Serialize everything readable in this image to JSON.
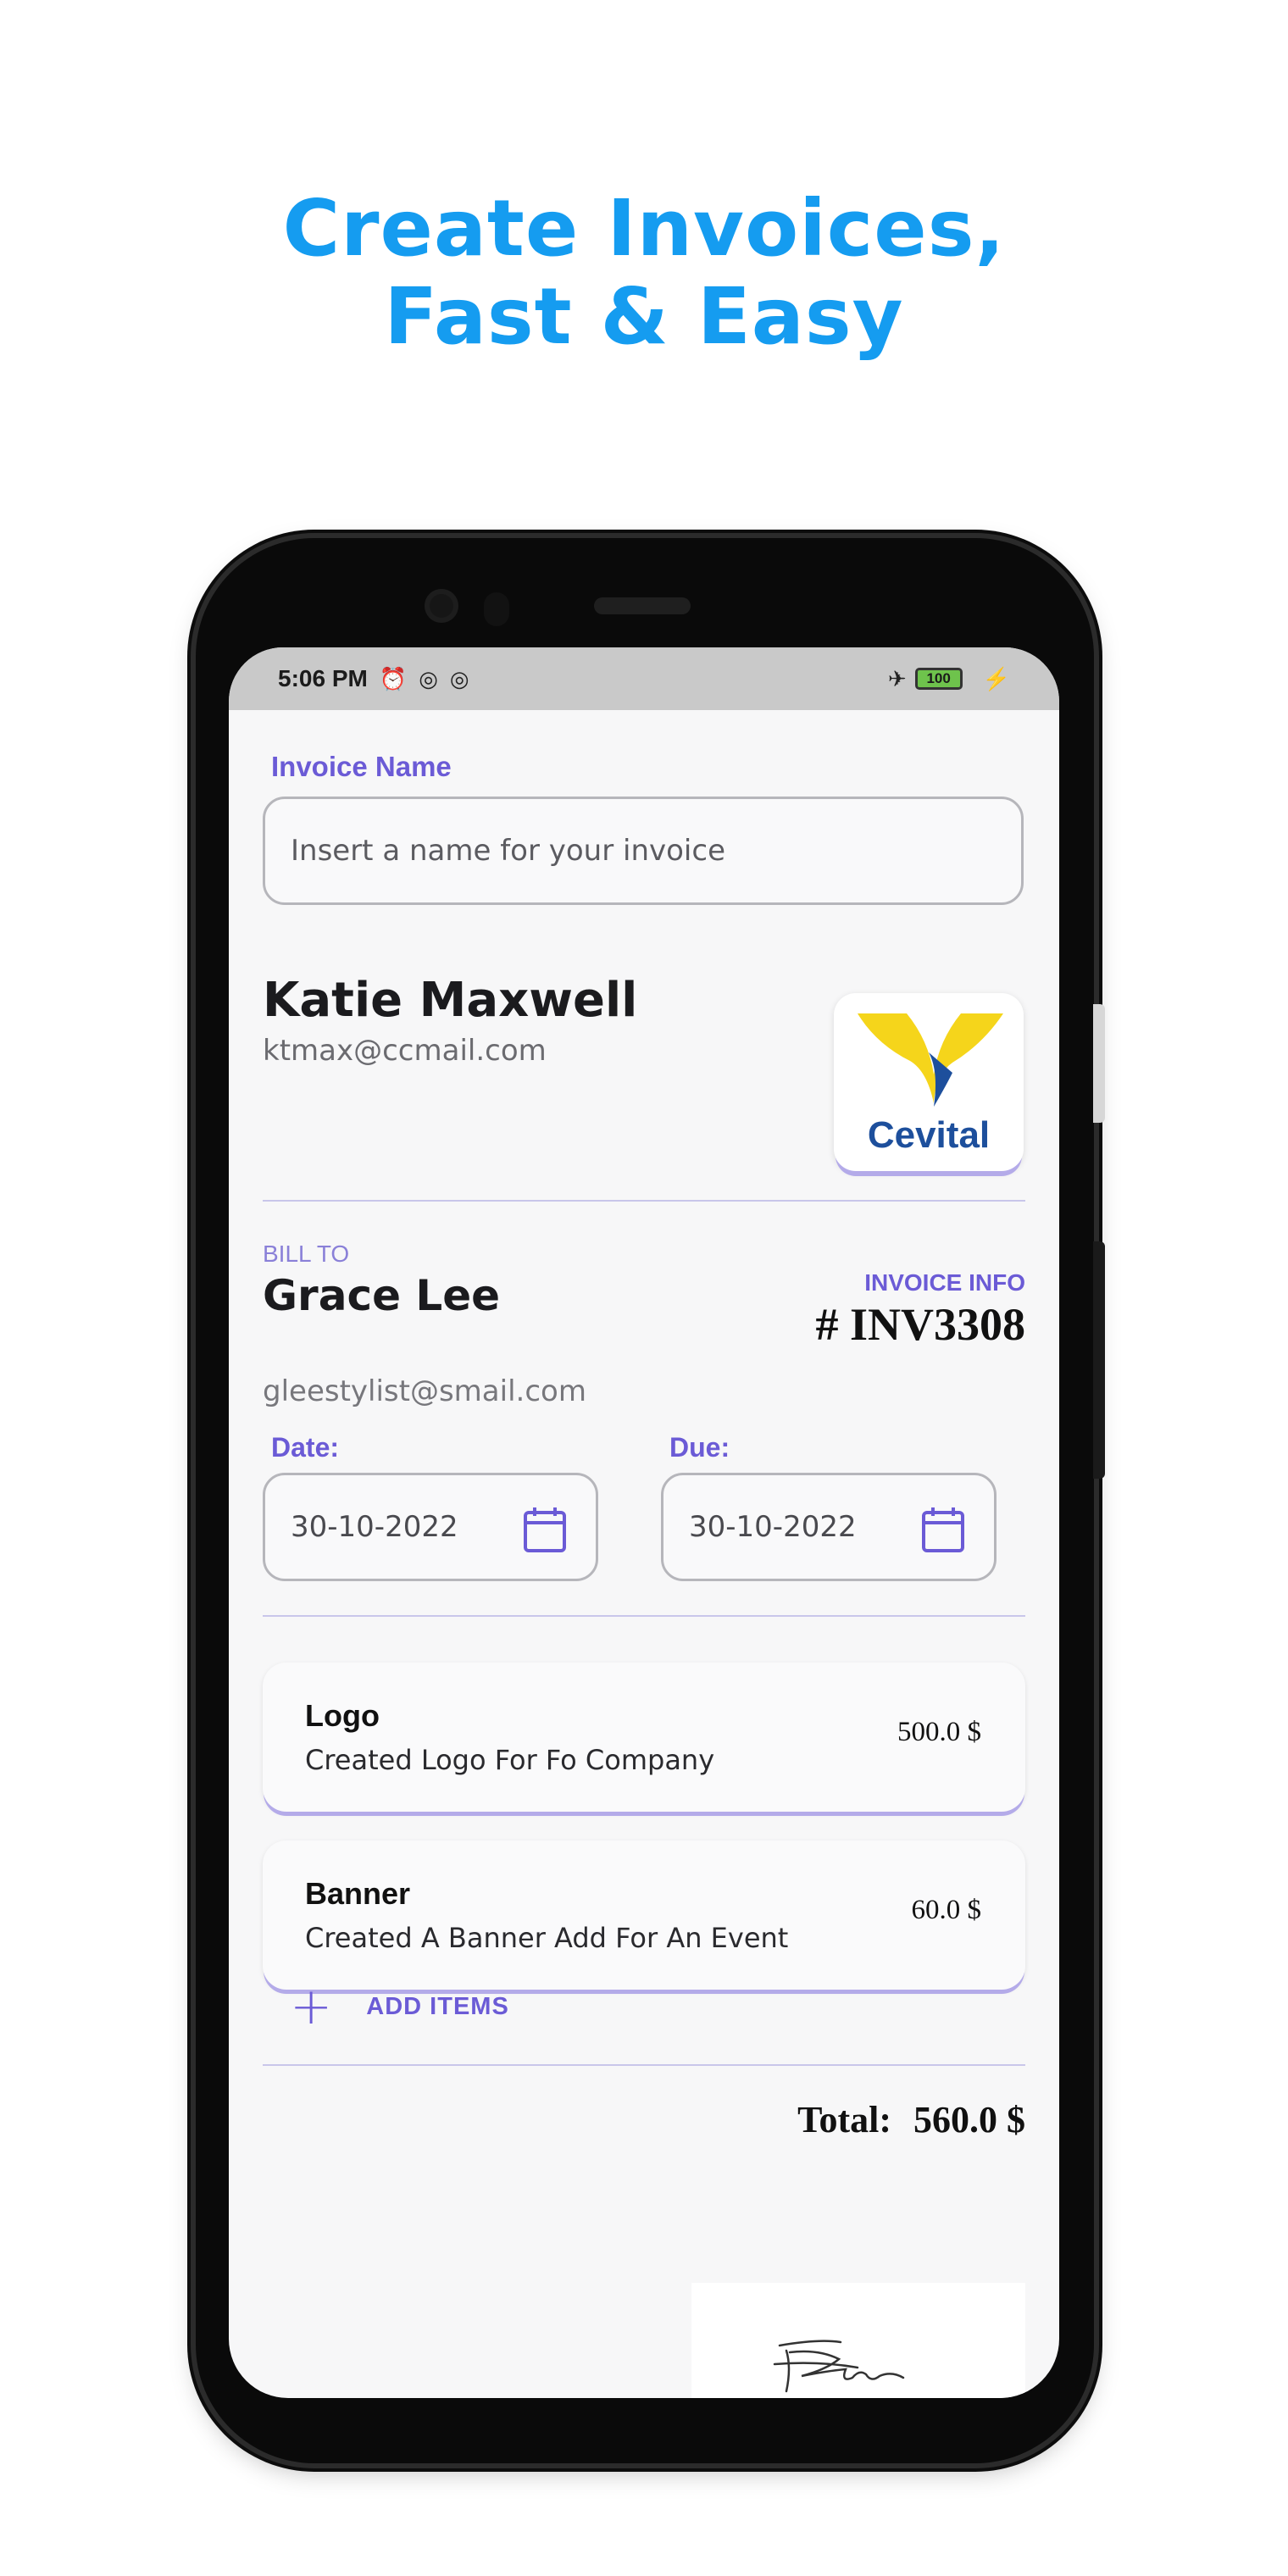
{
  "headline": {
    "line1": "Create Invoices,",
    "line2": "Fast & Easy"
  },
  "status_bar": {
    "time": "5:06 PM",
    "battery": "100"
  },
  "invoice_name": {
    "label": "Invoice Name",
    "placeholder": "Insert a name for your invoice"
  },
  "sender": {
    "name": "Katie Maxwell",
    "email": "ktmax@ccmail.com",
    "logo_text": "Cevital"
  },
  "bill_to": {
    "label": "BILL TO",
    "name": "Grace Lee",
    "email": "gleestylist@smail.com"
  },
  "invoice_info": {
    "label": "INVOICE INFO",
    "number": "# INV3308"
  },
  "dates": {
    "date_label": "Date:",
    "date_value": "30-10-2022",
    "due_label": "Due:",
    "due_value": "30-10-2022"
  },
  "items": [
    {
      "title": "Logo",
      "description": "Created Logo For Fo Company",
      "price": "500.0 $"
    },
    {
      "title": "Banner",
      "description": "Created A Banner Add For An Event",
      "price": "60.0 $"
    }
  ],
  "add_items_label": "ADD ITEMS",
  "total": {
    "label": "Total:",
    "value": "560.0 $"
  },
  "colors": {
    "accent": "#6b5bd6",
    "headline": "#159cf0",
    "logo_yellow": "#f5d51b",
    "logo_blue": "#1d4f9c"
  }
}
